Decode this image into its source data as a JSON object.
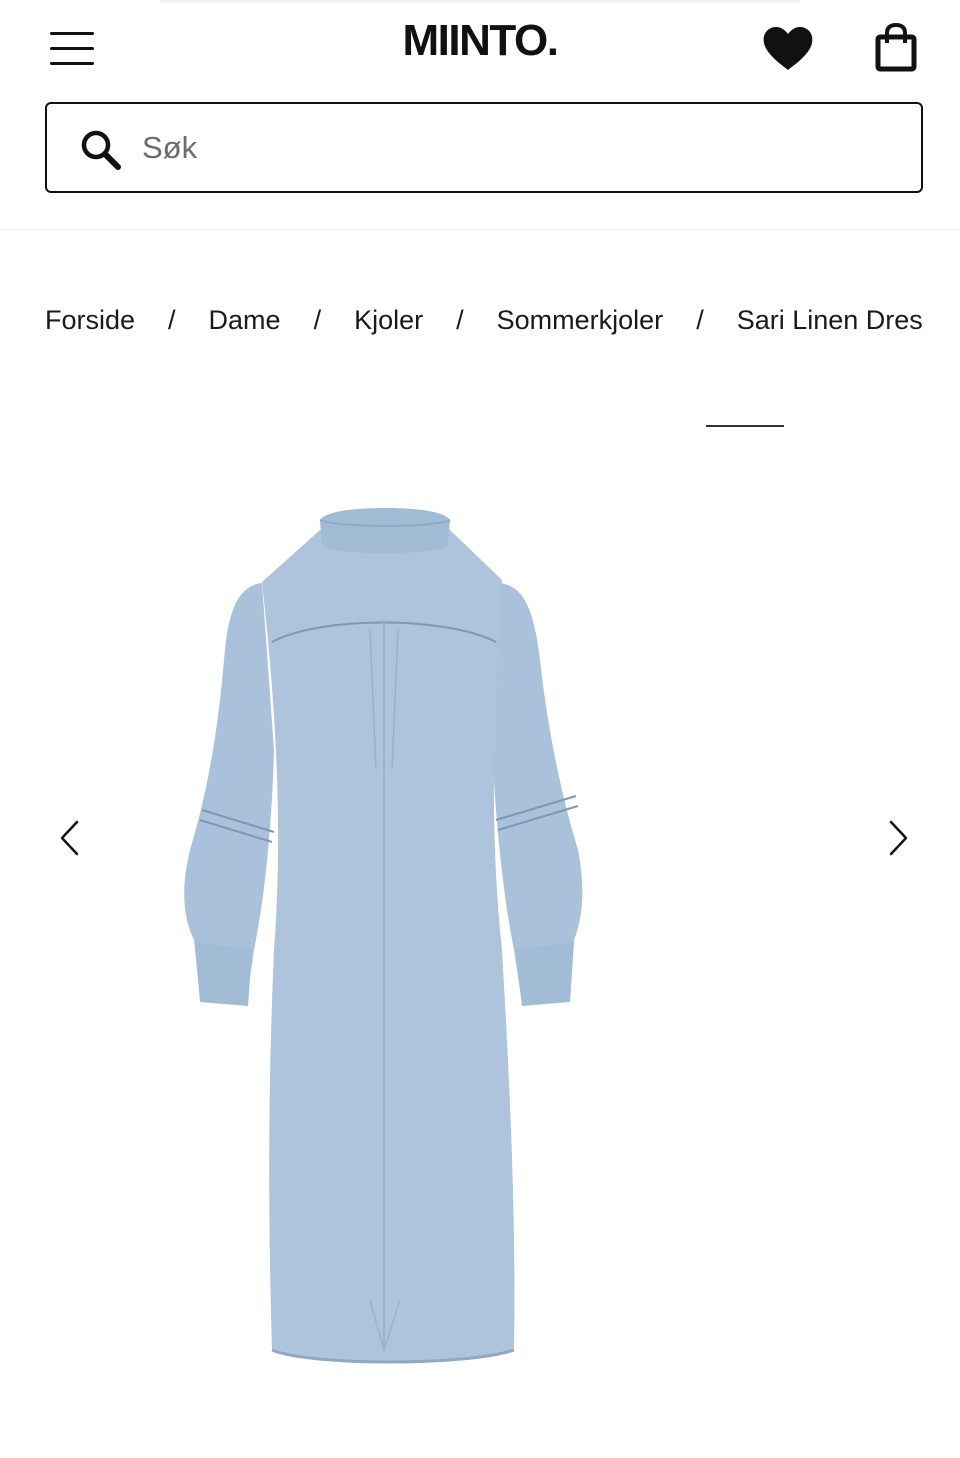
{
  "header": {
    "logo_text": "MIINTO.",
    "icons": {
      "menu": "hamburger-menu-icon",
      "wishlist": "heart-icon",
      "bag": "shopping-bag-icon"
    }
  },
  "search": {
    "placeholder": "Søk",
    "value": "",
    "icon": "search-icon"
  },
  "breadcrumb": {
    "items": [
      "Forside",
      "Dame",
      "Kjoler",
      "Sommerkjoler",
      "Sari Linen Dress"
    ],
    "separator": "/"
  },
  "gallery": {
    "image_subject": "Light blue linen shirt dress, back view",
    "image_progress": 1,
    "prev_icon": "chevron-left-icon",
    "next_icon": "chevron-right-icon",
    "colors": {
      "dress": "#a9c1da",
      "dress_shadow": "#8fa9c4"
    }
  }
}
